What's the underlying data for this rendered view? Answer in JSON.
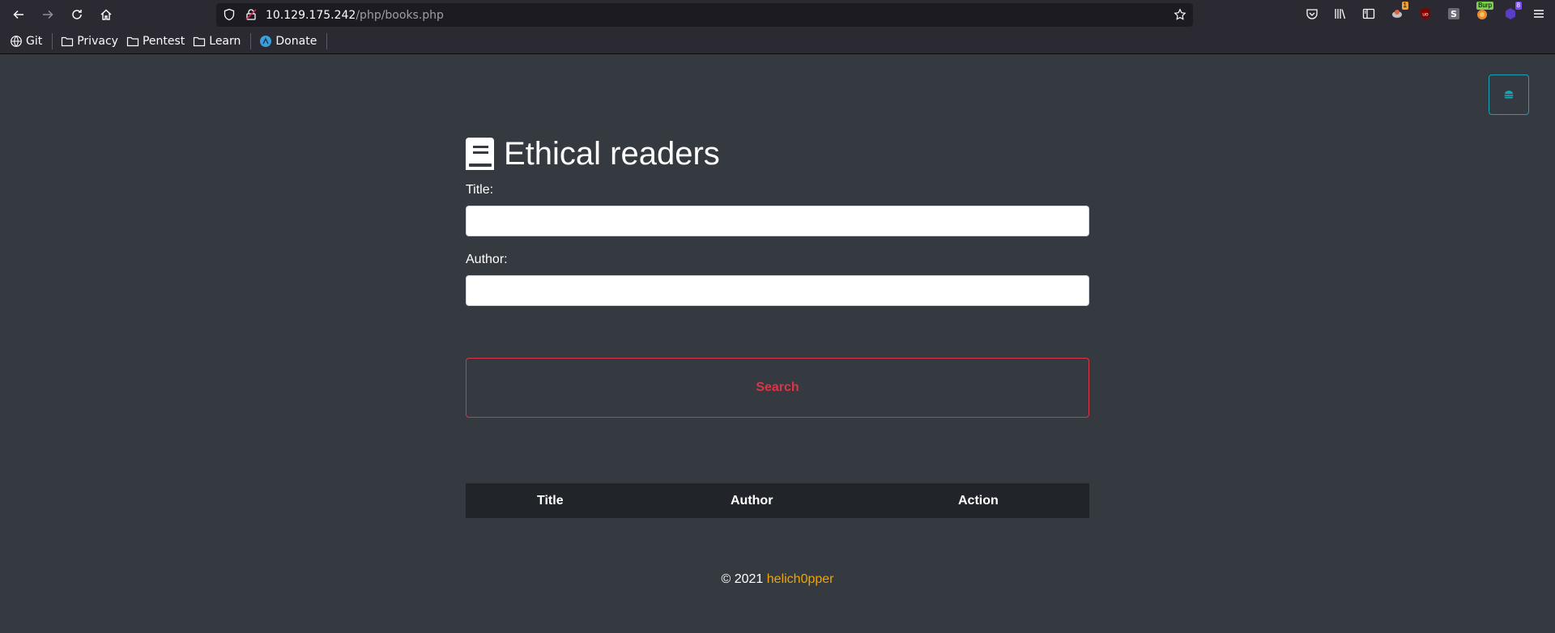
{
  "browser": {
    "url_host": "10.129.175.242",
    "url_path": "/php/books.php",
    "bookmarks": [
      {
        "label": "Git",
        "icon": "globe-icon"
      },
      {
        "label": "Privacy",
        "icon": "folder-icon"
      },
      {
        "label": "Pentest",
        "icon": "folder-icon"
      },
      {
        "label": "Learn",
        "icon": "folder-icon"
      },
      {
        "label": "Donate",
        "icon": "donate-icon"
      }
    ],
    "extension_badges": {
      "ext1": "1",
      "burp": "Burp",
      "ext2": "8"
    }
  },
  "page": {
    "title": "Ethical readers",
    "form": {
      "title_label": "Title:",
      "title_value": "",
      "author_label": "Author:",
      "author_value": "",
      "search_label": "Search"
    },
    "table": {
      "headers": [
        "Title",
        "Author",
        "Action"
      ]
    },
    "footer": {
      "copyright": "© 2021",
      "author_link": "helich0pper"
    }
  },
  "colors": {
    "background": "#343a40",
    "search_button": "#dc3545",
    "menu_toggle": "#17a2b8",
    "footer_link": "#f0a500",
    "table_header": "#212529"
  }
}
